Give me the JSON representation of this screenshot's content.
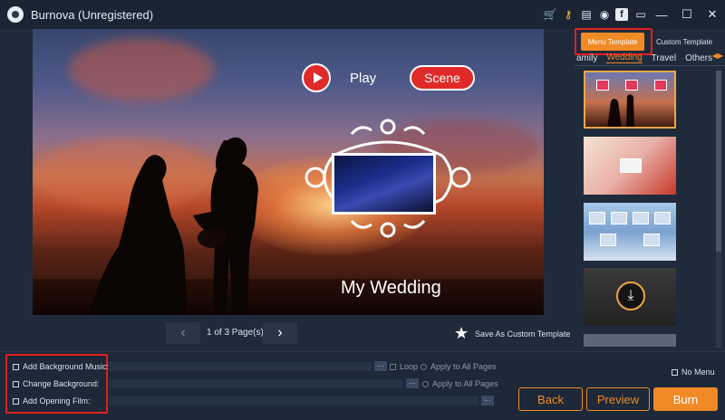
{
  "app": {
    "title": "Burnova (Unregistered)"
  },
  "titlebar": {
    "icons": [
      "cart-icon",
      "key-icon",
      "document-icon",
      "chat-icon",
      "facebook-icon",
      "message-icon",
      "minimize-icon",
      "maximize-icon",
      "close-icon"
    ],
    "facebook_glyph": "f",
    "minimize_glyph": "—",
    "maximize_glyph": "☐",
    "close_glyph": "✕"
  },
  "preview": {
    "play_label": "Play",
    "scene_label": "Scene",
    "title_text": "My Wedding"
  },
  "pager": {
    "page_text": "1 of 3 Page(s)",
    "prev_glyph": "‹",
    "next_glyph": "›"
  },
  "save_template": {
    "label": "Save As Custom Template"
  },
  "right_panel": {
    "tabs": [
      {
        "label": "Menu Template",
        "active": true
      },
      {
        "label": "Custom Template",
        "active": false
      }
    ],
    "categories": [
      {
        "label": "amily",
        "active": false
      },
      {
        "label": "Wedding",
        "active": true
      },
      {
        "label": "Travel",
        "active": false
      },
      {
        "label": "Others",
        "active": false
      }
    ],
    "category_arrows": "◀▶",
    "download_glyph": "⤓"
  },
  "options": {
    "background_music": "Add Background Music:",
    "change_background": "Change Background:",
    "opening_film": "Add Opening Film:",
    "loop": "Loop",
    "apply_all_1": "Apply to All Pages",
    "apply_all_2": "Apply to All Pages",
    "no_menu": "No Menu",
    "dots": "···"
  },
  "buttons": {
    "back": "Back",
    "preview": "Preview",
    "burn": "Burn"
  },
  "colors": {
    "accent": "#f08a26",
    "highlight_red": "#e02020",
    "background": "#1f2b3b"
  }
}
